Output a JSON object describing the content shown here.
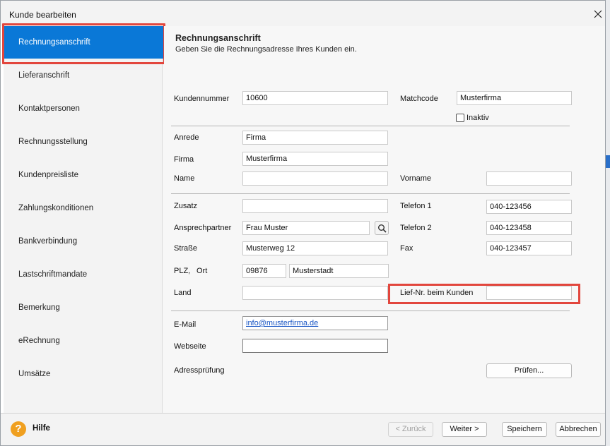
{
  "window": {
    "title": "Kunde bearbeiten"
  },
  "sidebar": {
    "items": [
      {
        "label": "Rechnungsanschrift",
        "active": true
      },
      {
        "label": "Lieferanschrift"
      },
      {
        "label": "Kontaktpersonen"
      },
      {
        "label": "Rechnungsstellung"
      },
      {
        "label": "Kundenpreisliste"
      },
      {
        "label": "Zahlungskonditionen"
      },
      {
        "label": "Bankverbindung"
      },
      {
        "label": "Lastschriftmandate"
      },
      {
        "label": "Bemerkung"
      },
      {
        "label": "eRechnung"
      },
      {
        "label": "Umsätze"
      }
    ]
  },
  "header": {
    "title": "Rechnungsanschrift",
    "subtitle": "Geben Sie die Rechnungsadresse Ihres Kunden ein."
  },
  "form": {
    "kundennummer": {
      "label": "Kundennummer",
      "value": "10600"
    },
    "matchcode": {
      "label": "Matchcode",
      "value": "Musterfirma"
    },
    "inaktiv": {
      "label": "Inaktiv",
      "checked": false
    },
    "anrede": {
      "label": "Anrede",
      "value": "Firma"
    },
    "firma": {
      "label": "Firma",
      "value": "Musterfirma"
    },
    "name": {
      "label": "Name",
      "value": ""
    },
    "vorname": {
      "label": "Vorname",
      "value": ""
    },
    "zusatz": {
      "label": "Zusatz",
      "value": ""
    },
    "telefon1": {
      "label": "Telefon 1",
      "value": "040-123456"
    },
    "ansprechpartner": {
      "label": "Ansprechpartner",
      "value": "Frau Muster"
    },
    "telefon2": {
      "label": "Telefon 2",
      "value": "040-123458"
    },
    "strasse": {
      "label": "Straße",
      "value": "Musterweg 12"
    },
    "fax": {
      "label": "Fax",
      "value": "040-123457"
    },
    "plz_ort": {
      "label_plz": "PLZ,",
      "label_ort": "Ort",
      "plz": "09876",
      "ort": "Musterstadt"
    },
    "land": {
      "label": "Land",
      "value": ""
    },
    "lief_nr": {
      "label": "Lief-Nr. beim Kunden",
      "value": ""
    },
    "email": {
      "label": "E-Mail",
      "value": "info@musterfirma.de"
    },
    "webseite": {
      "label": "Webseite",
      "value": ""
    },
    "adresspruefung": {
      "label": "Adressprüfung",
      "button": "Prüfen..."
    }
  },
  "footer": {
    "help": "Hilfe",
    "back": "< Zurück",
    "next": "Weiter >",
    "save": "Speichern",
    "cancel": "Abbrechen"
  },
  "icons": [
    "close-icon",
    "search-icon",
    "help-icon"
  ],
  "colors": {
    "accent": "#0a78d7",
    "highlight": "#e2463d",
    "help": "#f0a020"
  }
}
